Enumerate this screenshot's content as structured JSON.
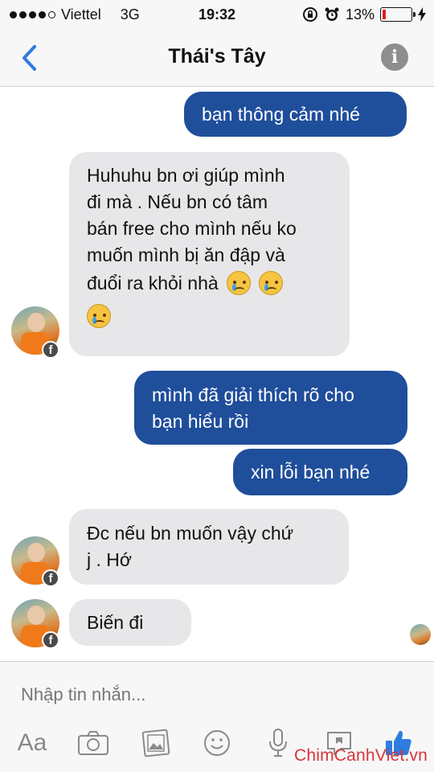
{
  "status": {
    "carrier": "Viettel",
    "network": "3G",
    "time": "19:32",
    "battery_percent": "13%",
    "battery_level": 0.13
  },
  "header": {
    "title": "Thái's Tây",
    "info_icon": "info-icon",
    "back_icon": "chevron-left-icon"
  },
  "messages": [
    {
      "side": "out",
      "lines": [
        "bạn thông cảm nhé"
      ]
    },
    {
      "side": "in",
      "lines": [
        "Huhuhu bn ơi giúp mình",
        "đi mà . Nếu bn có tâm",
        "bán free cho mình nếu ko",
        "muốn mình bị ăn đập và",
        "đuổi ra khỏi nhà"
      ]
    },
    {
      "side": "out",
      "lines": [
        "mình đã giải thích rõ cho",
        "bạn hiểu rồi"
      ]
    },
    {
      "side": "out",
      "lines": [
        "xin lỗi bạn nhé"
      ]
    },
    {
      "side": "in",
      "lines": [
        "Đc nếu bn muốn vậy chứ",
        "j . Hớ"
      ]
    },
    {
      "side": "in",
      "lines": [
        "Biến đi"
      ]
    }
  ],
  "composer": {
    "placeholder": "Nhập tin nhắn...",
    "aa_label": "Aa",
    "tools": [
      "camera-icon",
      "gallery-icon",
      "emoji-icon",
      "microphone-icon",
      "sticker-icon",
      "like-icon"
    ]
  },
  "watermark": "ChimCanhViet.vn",
  "colors": {
    "outgoing_bubble": "#1f4e9b",
    "incoming_bubble": "#e7e7e9",
    "accent": "#2f7ce0",
    "battery_low": "#e02020"
  }
}
